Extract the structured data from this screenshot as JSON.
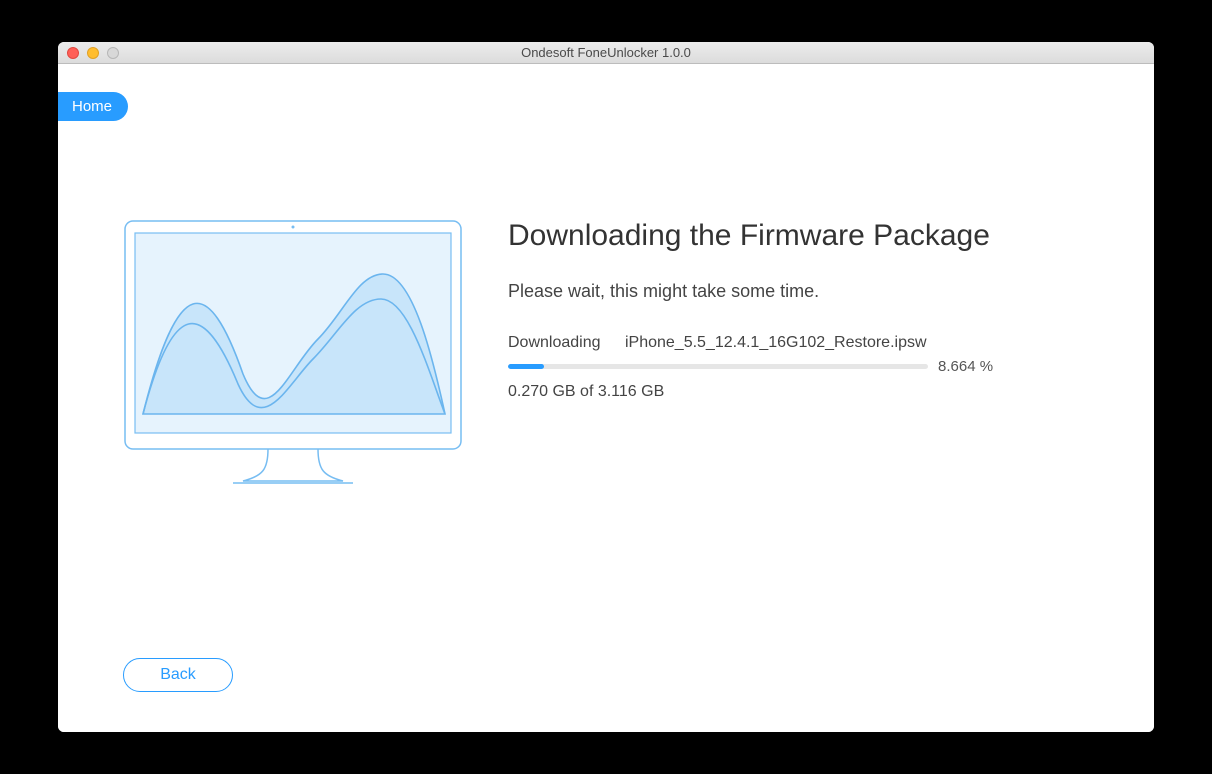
{
  "window": {
    "title": "Ondesoft FoneUnlocker 1.0.0"
  },
  "nav": {
    "home_label": "Home"
  },
  "main": {
    "heading": "Downloading the Firmware Package",
    "subtitle": "Please wait, this might take some time.",
    "download": {
      "label": "Downloading",
      "filename": "iPhone_5.5_12.4.1_16G102_Restore.ipsw",
      "percent_text": "8.664 %",
      "percent_value": 8.664,
      "amount": "0.270 GB of 3.116 GB"
    }
  },
  "footer": {
    "back_label": "Back"
  }
}
